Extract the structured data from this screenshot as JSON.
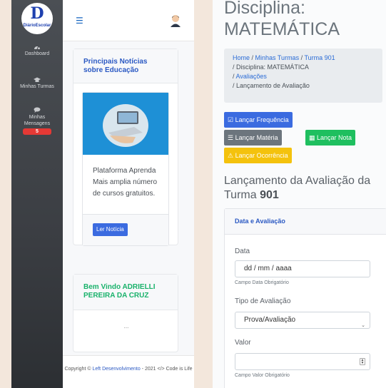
{
  "left": {
    "logo_text": "DiárioEscolar",
    "sidebar": {
      "items": [
        {
          "label": "Dashboard",
          "icon": "dashboard-icon"
        },
        {
          "label": "Minhas Turmas",
          "icon": "graduation-cap-icon"
        },
        {
          "label": "Minhas Mensagens",
          "icon": "message-icon",
          "badge": "5"
        }
      ]
    },
    "header": {
      "menu_icon": "hamburger-icon",
      "avatar_icon": "user-avatar-icon"
    },
    "news_card": {
      "title": "Principais Notícias sobre Educação",
      "text": "Plataforma Aprenda Mais amplia número de cursos gratuitos.",
      "button": "Ler Notícia"
    },
    "welcome_card": {
      "title": "Bem Vindo ADRIELLI PEREIRA DA CRUZ",
      "body": "..."
    },
    "footer": {
      "prefix": "Copyright © ",
      "link": "Left Desenvolvimento",
      "suffix": " - 2021 </> Code is Life"
    }
  },
  "right": {
    "discipline_title": "Disciplina: MATEMÁTICA",
    "breadcrumb": [
      {
        "label": "Home",
        "link": true
      },
      {
        "label": "Minhas Turmas",
        "link": true
      },
      {
        "label": "Turma 901",
        "link": true
      },
      {
        "label": "Disciplina: MATEMÁTICA",
        "link": false
      },
      {
        "label": "Avaliações",
        "link": true
      },
      {
        "label": "Lançamento de Avaliação",
        "link": false
      }
    ],
    "buttons": {
      "frequencia": "Lançar Frequência",
      "materia": "Lançar Matéria",
      "nota": "Lançar Nota",
      "ocorrencia": "Lançar Ocorrência"
    },
    "launch_title_prefix": "Lançamento da Avaliação da Turma ",
    "launch_title_class": "901",
    "form": {
      "header": "Data e Avaliação",
      "date_label": "Data",
      "date_value": "dd / mm / aaaa",
      "date_hint": "Campo Data Obrigatório",
      "type_label": "Tipo de Avaliação",
      "type_value": "Prova/Avaliação",
      "value_label": "Valor",
      "value_value": "",
      "value_hint": "Campo Valor Obrigatório"
    }
  },
  "colors": {
    "background": "#f3e7dc",
    "sidebar": "#3b3e43",
    "primary": "#3b6be0",
    "success": "#1fbf5f",
    "warning": "#f4c20d",
    "secondary": "#6c757d",
    "danger": "#e53935"
  }
}
